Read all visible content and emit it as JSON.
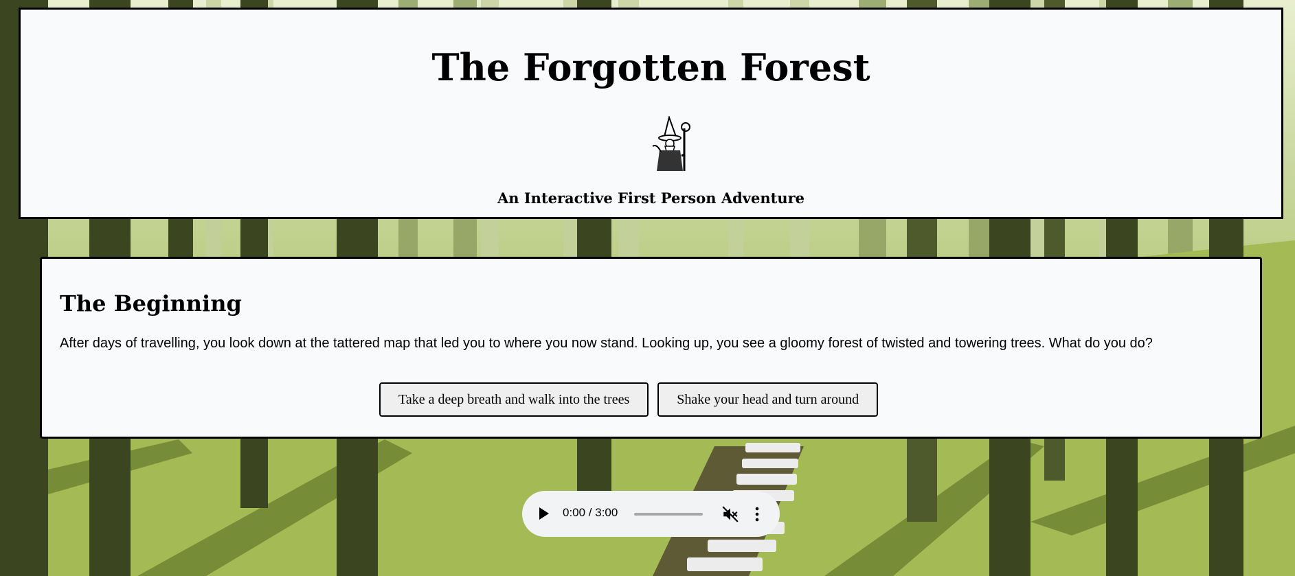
{
  "header": {
    "title": "The Forgotten Forest",
    "subtitle": "An Interactive First Person Adventure",
    "logo_icon": "wizard-icon"
  },
  "scene": {
    "heading": "The Beginning",
    "text": "After days of travelling, you look down at the tattered map that led you to where you now stand. Looking up, you see a gloomy forest of twisted and towering trees. What do you do?",
    "choices": [
      {
        "label": "Take a deep breath and walk into the trees"
      },
      {
        "label": "Shake your head and turn around"
      }
    ]
  },
  "audio": {
    "time": "0:00 / 3:00",
    "progress": 0,
    "muted": true,
    "play_icon": "play-icon",
    "volume_icon": "volume-muted-icon",
    "menu_icon": "more-vertical-icon"
  }
}
